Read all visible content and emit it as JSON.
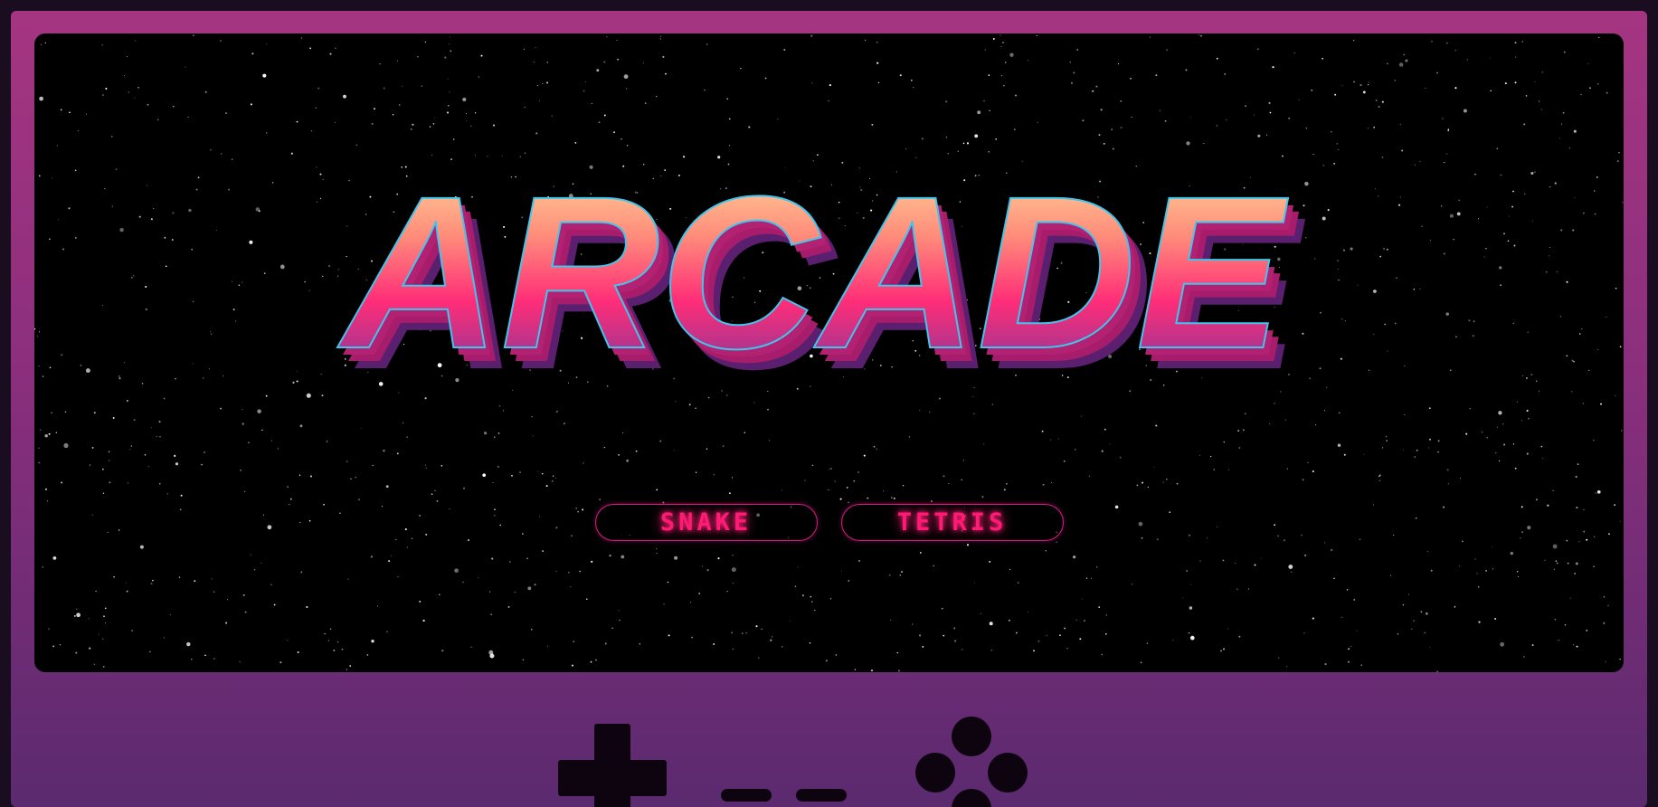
{
  "game": {
    "title": "ARCADE",
    "menu": [
      {
        "label": "SNAKE"
      },
      {
        "label": "TETRIS"
      }
    ]
  },
  "colors": {
    "console_top": "#a53581",
    "console_bottom": "#5b2a6f",
    "title_gradient": [
      "#ffe3a1",
      "#ff8c7a",
      "#ff2d78",
      "#6b3aa0"
    ],
    "title_outline": "#3ec7ee",
    "title_extrude": "#a81c6c",
    "button_text": "#ff1a74",
    "button_border": "#d81a86"
  },
  "icons": [
    "dpad-icon",
    "select-button-icon",
    "start-button-icon",
    "action-buttons-icon"
  ]
}
